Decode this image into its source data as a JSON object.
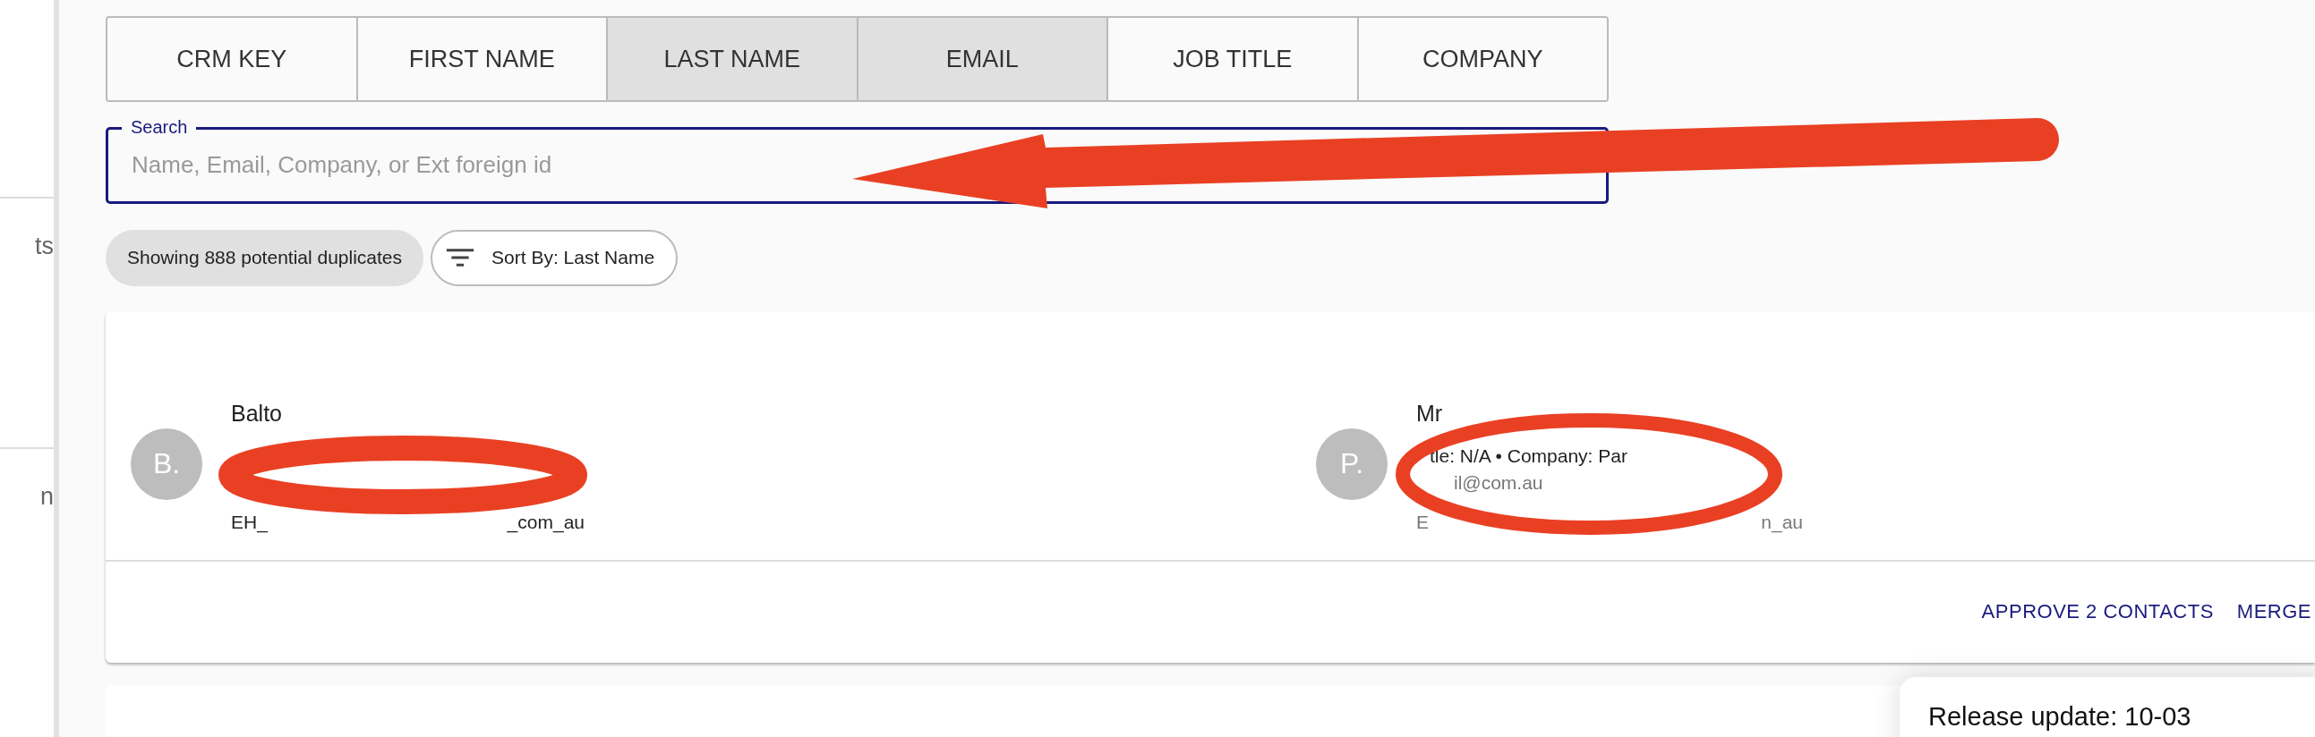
{
  "sidebar": {
    "items": [
      {
        "label": "ts"
      },
      {
        "label": "n"
      }
    ]
  },
  "filter_tabs": [
    {
      "label": "CRM KEY",
      "selected": false
    },
    {
      "label": "FIRST NAME",
      "selected": false
    },
    {
      "label": "LAST NAME",
      "selected": true
    },
    {
      "label": "EMAIL",
      "selected": true
    },
    {
      "label": "JOB TITLE",
      "selected": false
    },
    {
      "label": "COMPANY",
      "selected": false
    }
  ],
  "search": {
    "label": "Search",
    "placeholder": "Name, Email, Company, or Ext foreign id"
  },
  "result_count": "Showing 888 potential duplicates",
  "sort": {
    "label": "Sort By: Last Name"
  },
  "duplicate_group": {
    "contacts": [
      {
        "initial": "B.",
        "lines": [
          [
            "Balto"
          ],
          [
            "EH_",
            "_com_au"
          ]
        ]
      },
      {
        "initial": "P.",
        "lines": [
          [
            "Mr"
          ],
          [
            "tle: N/A • Company: Par"
          ],
          [
            "il@com.au"
          ],
          [
            "E",
            "n_au"
          ]
        ]
      }
    ],
    "actions": [
      {
        "label": "APPROVE 2 CONTACTS"
      },
      {
        "label": "MERGE"
      }
    ]
  },
  "notification": {
    "title": "Release update: 10-03"
  }
}
